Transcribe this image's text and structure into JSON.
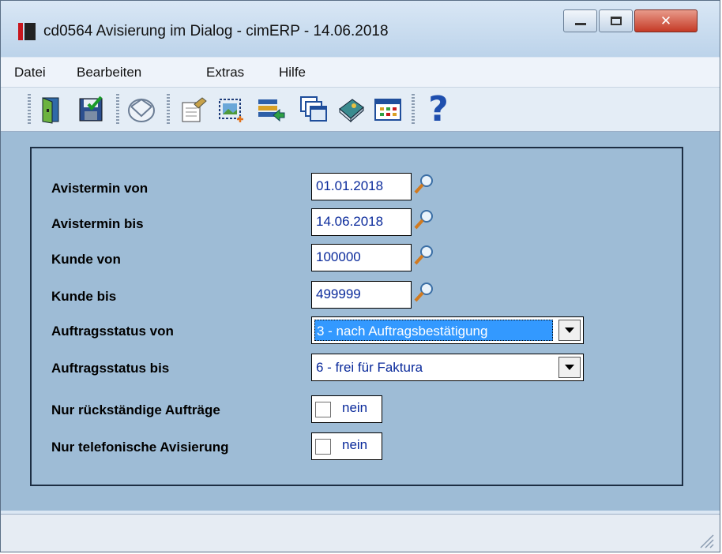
{
  "window": {
    "title": "cd0564 Avisierung im Dialog - cimERP - 14.06.2018",
    "controls": {
      "minimize": "minimize-icon",
      "maximize": "maximize-icon",
      "close": "close-icon"
    }
  },
  "menu": [
    "Datei",
    "Bearbeiten",
    "Extras",
    "Hilfe"
  ],
  "toolbar": {
    "icons": [
      "exit-door-icon",
      "save-icon",
      "envelope-icon",
      "edit-document-icon",
      "new-record-icon",
      "transfer-list-icon",
      "windows-icon",
      "book-icon",
      "table-icon",
      "help-icon"
    ],
    "help_glyph": "?"
  },
  "form": {
    "avistermin_von": {
      "label": "Avistermin von",
      "value": "01.01.2018"
    },
    "avistermin_bis": {
      "label": "Avistermin bis",
      "value": "14.06.2018"
    },
    "kunde_von": {
      "label": "Kunde von",
      "value": "100000"
    },
    "kunde_bis": {
      "label": "Kunde bis",
      "value": "499999"
    },
    "auftragsstatus_von": {
      "label": "Auftragsstatus von",
      "value": "3 - nach Auftragsbestätigung"
    },
    "auftragsstatus_bis": {
      "label": "Auftragsstatus bis",
      "value": "6 - frei für Faktura"
    },
    "nur_rueckstaendige": {
      "label": "Nur rückständige Aufträge",
      "checked": false,
      "text": "nein"
    },
    "nur_telefonische": {
      "label": "Nur telefonische Avisierung",
      "checked": false,
      "text": "nein"
    }
  },
  "colors": {
    "content_bg": "#9ebcd6",
    "field_text": "#0a2a9b",
    "selection": "#3399ff",
    "close_button": "#c53a26"
  }
}
